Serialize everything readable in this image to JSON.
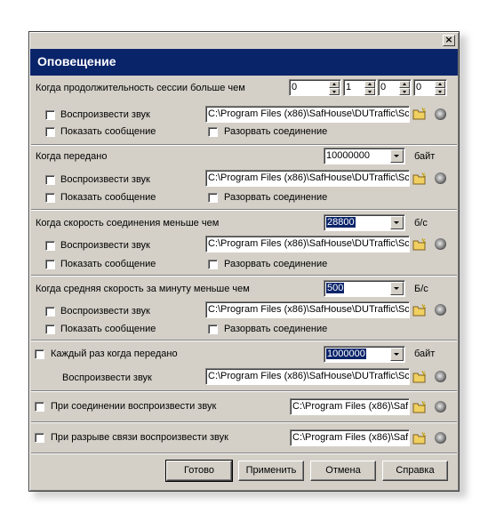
{
  "dialog": {
    "title": "Оповещение",
    "close_label": "×",
    "sound_path": "C:\\Program Files (x86)\\SafHouse\\DUTraffic\\Sc",
    "sound_path_short": "C:\\Program Files (x86)\\SafH"
  },
  "session": {
    "label": "Когда продолжительность сессии больше чем",
    "spin_values": [
      "0",
      "1",
      "0",
      "0"
    ],
    "play_sound": "Воспроизвести звук",
    "show_message": "Показать сообщение",
    "disconnect": "Разорвать соединение"
  },
  "transferred": {
    "label": "Когда передано",
    "value": "10000000",
    "unit": "байт",
    "play_sound": "Воспроизвести звук",
    "show_message": "Показать сообщение",
    "disconnect": "Разорвать соединение"
  },
  "speed": {
    "label": "Когда скорость соединения меньше чем",
    "value": "28800",
    "unit": "б/с",
    "play_sound": "Воспроизвести звук",
    "show_message": "Показать сообщение",
    "disconnect": "Разорвать соединение"
  },
  "avg_speed": {
    "label": "Когда средняя скорость за минуту меньше чем",
    "value": "500",
    "unit": "Б/с",
    "play_sound": "Воспроизвести звук",
    "show_message": "Показать сообщение",
    "disconnect": "Разорвать соединение"
  },
  "each_time": {
    "label": "Каждый раз когда передано",
    "value": "1000000",
    "unit": "байт",
    "play_sound": "Воспроизвести звук"
  },
  "on_connect": {
    "label": "При соединении воспроизвести звук"
  },
  "on_disconnect": {
    "label": "При разрыве связи воспроизвести звук"
  },
  "buttons": {
    "ok": "Готово",
    "apply": "Применить",
    "cancel": "Отмена",
    "help": "Справка"
  },
  "colors": {
    "header": "#0a246a",
    "face": "#d4d0c8"
  },
  "icons": [
    "close-icon",
    "folder-icon",
    "speaker-icon",
    "spin-up-icon",
    "spin-down-icon",
    "dropdown-arrow-icon"
  ]
}
